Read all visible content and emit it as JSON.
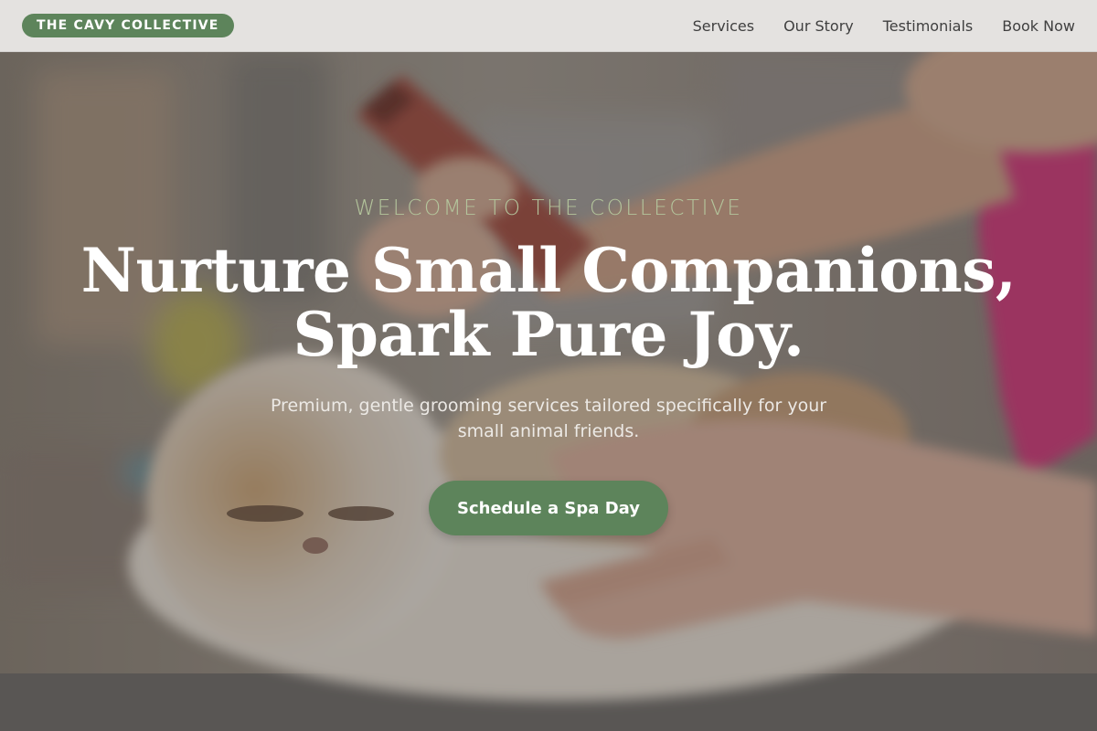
{
  "navbar": {
    "brand": "THE CAVY COLLECTIVE",
    "links": [
      "Services",
      "Our Story",
      "Testimonials",
      "Book Now"
    ]
  },
  "hero": {
    "eyebrow": "WELCOME TO THE COLLECTIVE",
    "headline": [
      "Nurture Small Companions,",
      "Spark Pure Joy."
    ],
    "subtitle": "Premium, gentle grooming services tailored specifically for your small animal friends.",
    "cta_label": "Schedule a Spa Day"
  },
  "colors": {
    "accent": "#5d845b",
    "navbar_bg": "#e4e2e0",
    "eyebrow": "#b4c59c",
    "headline": "#ffffff"
  }
}
